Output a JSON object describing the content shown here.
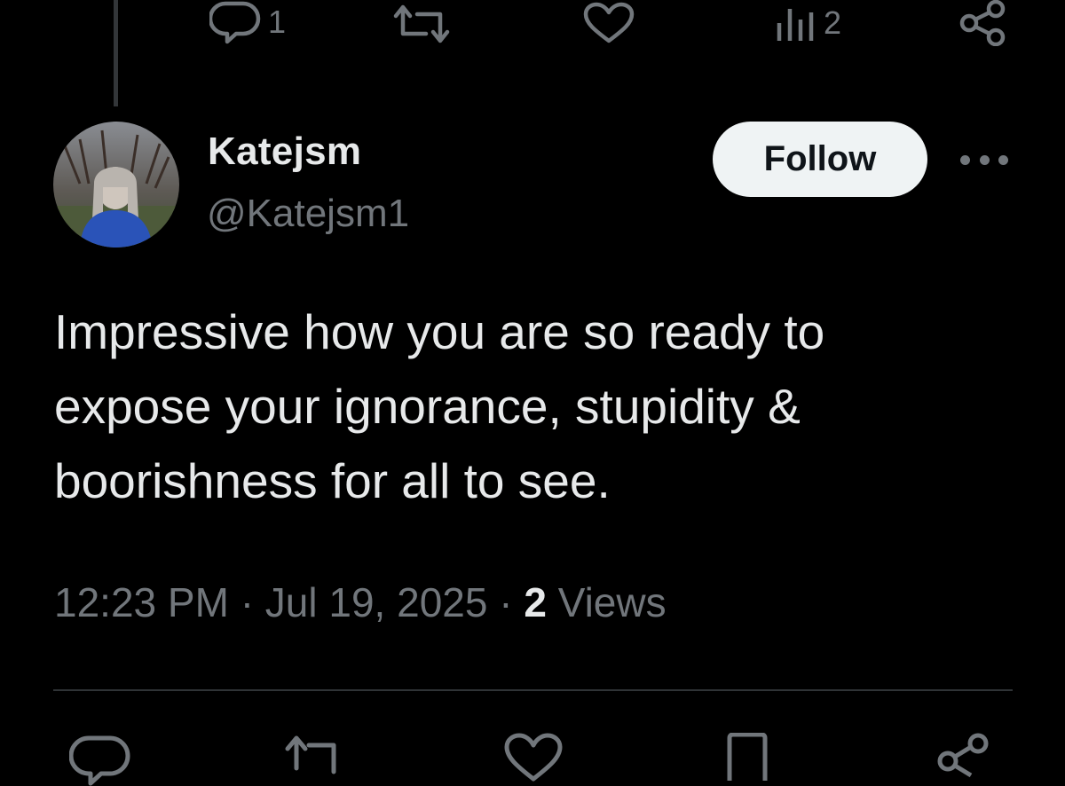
{
  "previous_tweet": {
    "actions": {
      "reply_count": "1",
      "retweet_count": "",
      "like_count": "",
      "views_count": "2"
    }
  },
  "tweet": {
    "author": {
      "display_name": "Katejsm",
      "handle": "@Katejsm1"
    },
    "follow_label": "Follow",
    "text_lines": [
      "Impressive how you are so ready to",
      "expose your ignorance, stupidity &",
      "boorishness for all to see."
    ],
    "time": "12:23 PM",
    "separator": "·",
    "date": "Jul 19, 2025",
    "views_count": "2",
    "views_label": "Views"
  },
  "icons": {
    "reply": "reply-icon",
    "retweet": "retweet-icon",
    "like": "heart-icon",
    "views": "views-icon",
    "share": "share-icon",
    "more": "more-icon",
    "bookmark": "bookmark-icon"
  },
  "colors": {
    "background": "#000000",
    "text_primary": "#e7e9ea",
    "text_secondary": "#71767b",
    "follow_bg": "#eff3f4",
    "divider": "#2f3336"
  }
}
